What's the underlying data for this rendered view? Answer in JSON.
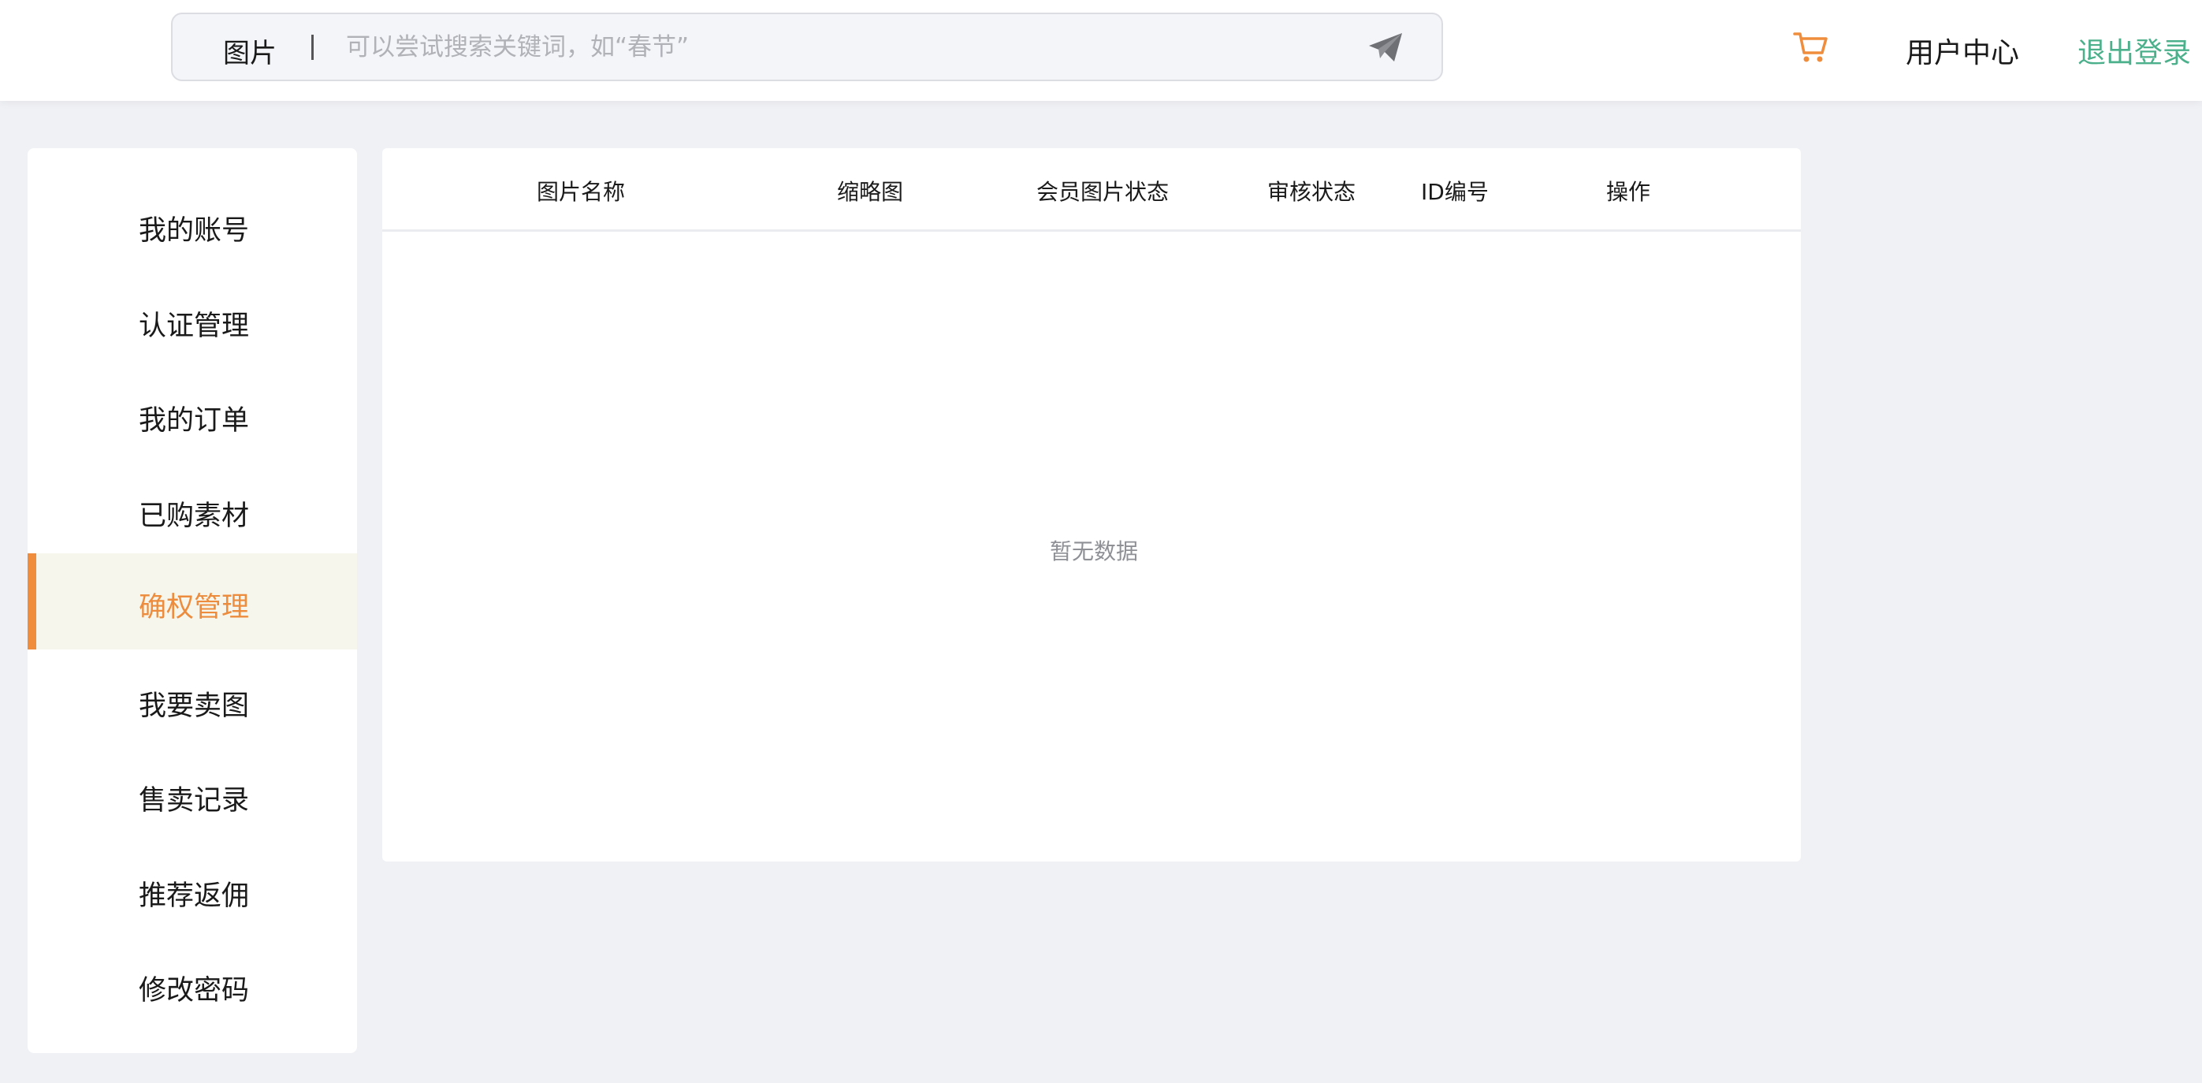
{
  "header": {
    "search": {
      "type_label": "图片",
      "placeholder": "可以尝试搜索关键词，如“春节”"
    },
    "user_center": "用户中心",
    "logout": "退出登录"
  },
  "sidebar": {
    "items": [
      {
        "label": "我的账号"
      },
      {
        "label": "认证管理"
      },
      {
        "label": "我的订单"
      },
      {
        "label": "已购素材"
      },
      {
        "label": "确权管理",
        "active": true
      },
      {
        "label": "我要卖图"
      },
      {
        "label": "售卖记录"
      },
      {
        "label": "推荐返佣"
      },
      {
        "label": "修改密码"
      }
    ]
  },
  "table": {
    "columns": [
      "图片名称",
      "缩略图",
      "会员图片状态",
      "审核状态",
      "ID编号",
      "操作"
    ],
    "empty_text": "暂无数据"
  },
  "colors": {
    "accent": "#ef8d3d",
    "active_bg": "#f7f6ed",
    "logout": "#4cb08c",
    "page_bg": "#f0f1f5"
  },
  "icons": {
    "send": "paper-plane-icon",
    "cart": "shopping-cart-icon"
  }
}
